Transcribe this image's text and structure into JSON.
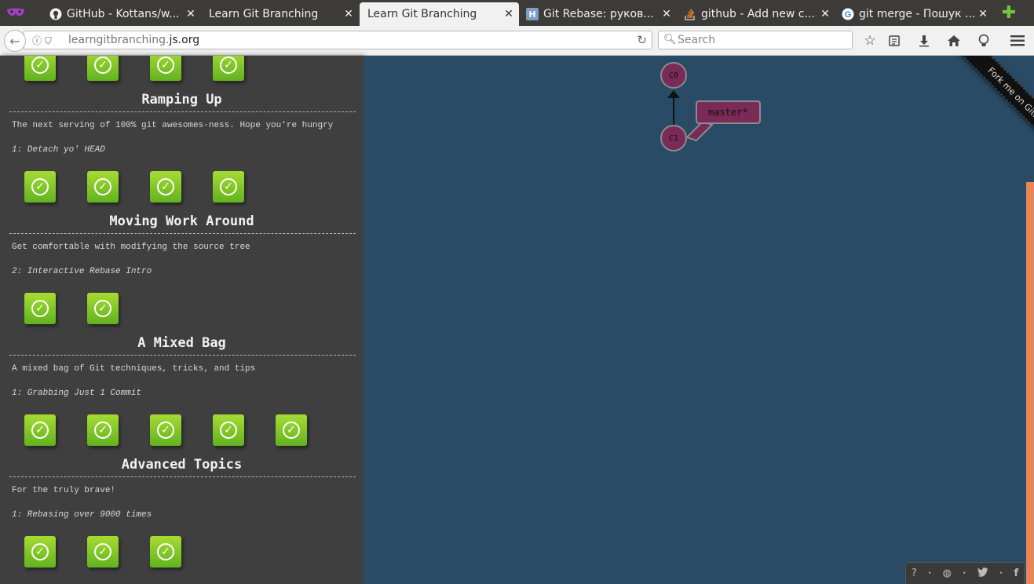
{
  "tabs": [
    {
      "title": "GitHub - Kottans/w...",
      "favicon": "github-icon",
      "active": false
    },
    {
      "title": "Learn Git Branching",
      "favicon": "none",
      "active": false
    },
    {
      "title": "Learn Git Branching",
      "favicon": "none",
      "active": true
    },
    {
      "title": "Git Rebase: руков...",
      "favicon": "H",
      "active": false
    },
    {
      "title": "github - Add new c...",
      "favicon": "stackoverflow-icon",
      "active": false
    },
    {
      "title": "git merge - Пошук ...",
      "favicon": "google-icon",
      "active": false
    }
  ],
  "tab_close_glyph": "✕",
  "new_tab_glyph": "✚",
  "navbar": {
    "url_path": "learngitbranching.",
    "url_domain": "js.org",
    "search_placeholder": "Search",
    "back_glyph": "←",
    "reload_glyph": "↻"
  },
  "sections": [
    {
      "title": "Ramping Up",
      "description": "The next serving of 100% git awesomes-ness. Hope you're hungry",
      "current_level": "1: Detach yo' HEAD",
      "completed_levels": 4
    },
    {
      "title": "Moving Work Around",
      "description": "Get comfortable with modifying the source tree",
      "current_level": "2: Interactive Rebase Intro",
      "completed_levels": 2
    },
    {
      "title": "A Mixed Bag",
      "description": "A mixed bag of Git techniques, tricks, and tips",
      "current_level": "1: Grabbing Just 1 Commit",
      "completed_levels": 5
    },
    {
      "title": "Advanced Topics",
      "description": "For the truly brave!",
      "current_level": "1: Rebasing over 9000 times",
      "completed_levels": 3
    }
  ],
  "top_completed_levels": 4,
  "check_glyph": "✓",
  "git_graph": {
    "commits": [
      "C0",
      "C1"
    ],
    "branch_label": "master*"
  },
  "ribbon_text": "Fork me on GitHub",
  "footer_icons": [
    "help-icon",
    "globe-icon",
    "twitter-icon",
    "facebook-icon"
  ],
  "footer_glyphs": [
    "?",
    "◍",
    "🐦",
    "f"
  ],
  "colors": {
    "canvas_bg": "#2a4b66",
    "panel_bg": "#3f3f3f",
    "commit_fill": "#7a2a56",
    "check_green": "#7bc22a",
    "accent_orange": "#e8865a"
  }
}
